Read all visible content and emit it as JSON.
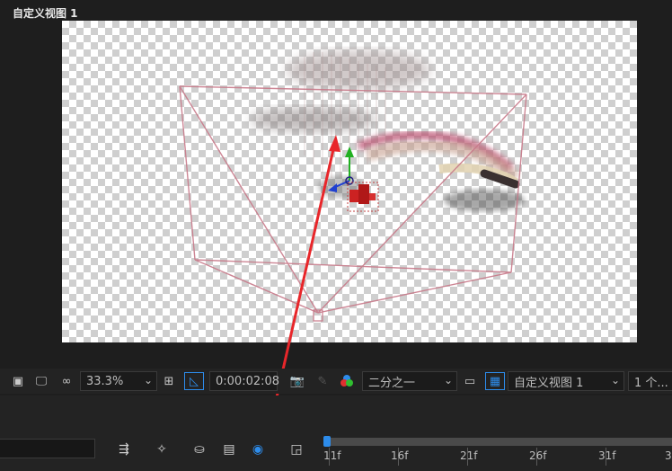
{
  "view_title": "自定义视图 1",
  "toolbar": {
    "zoom": "33.3%",
    "timecode": "0:00:02:08",
    "resolution": "二分之一",
    "view": "自定义视图 1",
    "views_count": "1 个..."
  },
  "timeline": {
    "ruler_labels": [
      "11f",
      "16f",
      "21f",
      "26f",
      "31f",
      "3"
    ]
  },
  "colors": {
    "annotation_arrow": "#e8262a",
    "playhead": "#2d8ceb",
    "camera_frame": "#c87a8a"
  }
}
